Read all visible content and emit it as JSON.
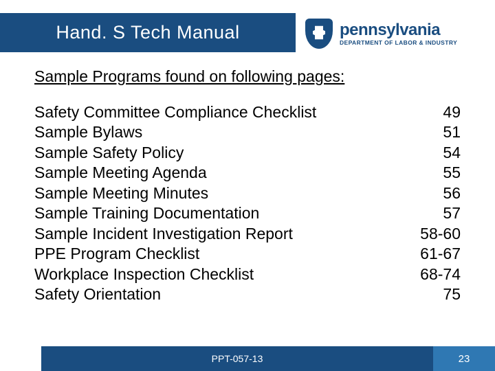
{
  "header": {
    "title": "Hand. S Tech Manual"
  },
  "logo": {
    "state": "pennsylvania",
    "dept": "DEPARTMENT OF LABOR & INDUSTRY"
  },
  "content": {
    "intro": "Sample Programs found on following pages:",
    "items": [
      {
        "name": "Safety Committee Compliance Checklist",
        "page": "49"
      },
      {
        "name": "Sample Bylaws",
        "page": "51"
      },
      {
        "name": "Sample Safety Policy",
        "page": "54"
      },
      {
        "name": "Sample Meeting Agenda",
        "page": "55"
      },
      {
        "name": "Sample Meeting Minutes",
        "page": "56"
      },
      {
        "name": "Sample Training Documentation",
        "page": "57"
      },
      {
        "name": "Sample Incident Investigation Report",
        "page": "58-60"
      },
      {
        "name": "PPE Program Checklist",
        "page": "61-67"
      },
      {
        "name": "Workplace Inspection Checklist",
        "page": "68-74"
      },
      {
        "name": "Safety Orientation",
        "page": "75"
      }
    ]
  },
  "footer": {
    "code": "PPT-057-13",
    "page": "23"
  }
}
